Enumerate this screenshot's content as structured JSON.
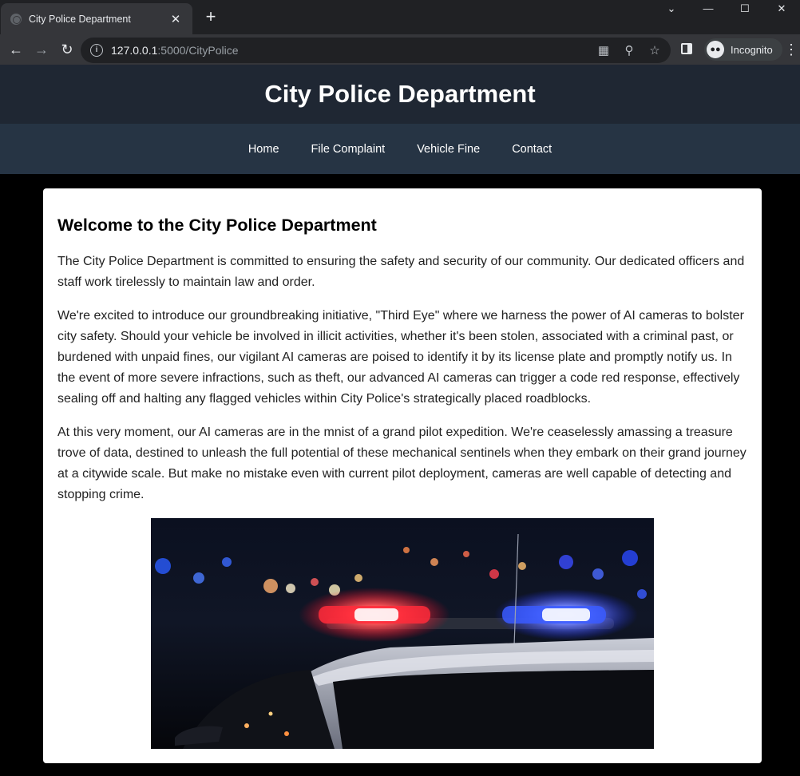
{
  "browser": {
    "tab_title": "City Police Department",
    "tab_close": "✕",
    "new_tab": "+",
    "url_host": "127.0.0.1",
    "url_rest": ":5000/CityPolice",
    "profile_label": "Incognito",
    "window_controls": {
      "dropdown": "⌄",
      "minimize": "—",
      "maximize": "☐",
      "close": "✕"
    }
  },
  "site": {
    "title": "City Police Department",
    "nav": [
      "Home",
      "File Complaint",
      "Vehicle Fine",
      "Contact"
    ]
  },
  "main": {
    "heading": "Welcome to the City Police Department",
    "paragraphs": [
      "The City Police Department is committed to ensuring the safety and security of our community. Our dedicated officers and staff work tirelessly to maintain law and order.",
      "We're excited to introduce our groundbreaking initiative, \"Third Eye\" where we harness the power of AI cameras to bolster city safety. Should your vehicle be involved in illicit activities, whether it's been stolen, associated with a criminal past, or burdened with unpaid fines, our vigilant AI cameras are poised to identify it by its license plate and promptly notify us. In the event of more severe infractions, such as theft, our advanced AI cameras can trigger a code red response, effectively sealing off and halting any flagged vehicles within City Police's strategically placed roadblocks.",
      "At this very moment, our AI cameras are in the mnist of a grand pilot expedition. We're ceaselessly amassing a treasure trove of data, destined to unleash the full potential of these mechanical sentinels when they embark on their grand journey at a citywide scale. But make no mistake even with current pilot deployment, cameras are well capable of detecting and stopping crime."
    ]
  },
  "colors": {
    "header_bg": "#1f2733",
    "nav_bg": "#263444",
    "siren_red": "#ff2a3a",
    "siren_blue": "#3a5bff"
  }
}
